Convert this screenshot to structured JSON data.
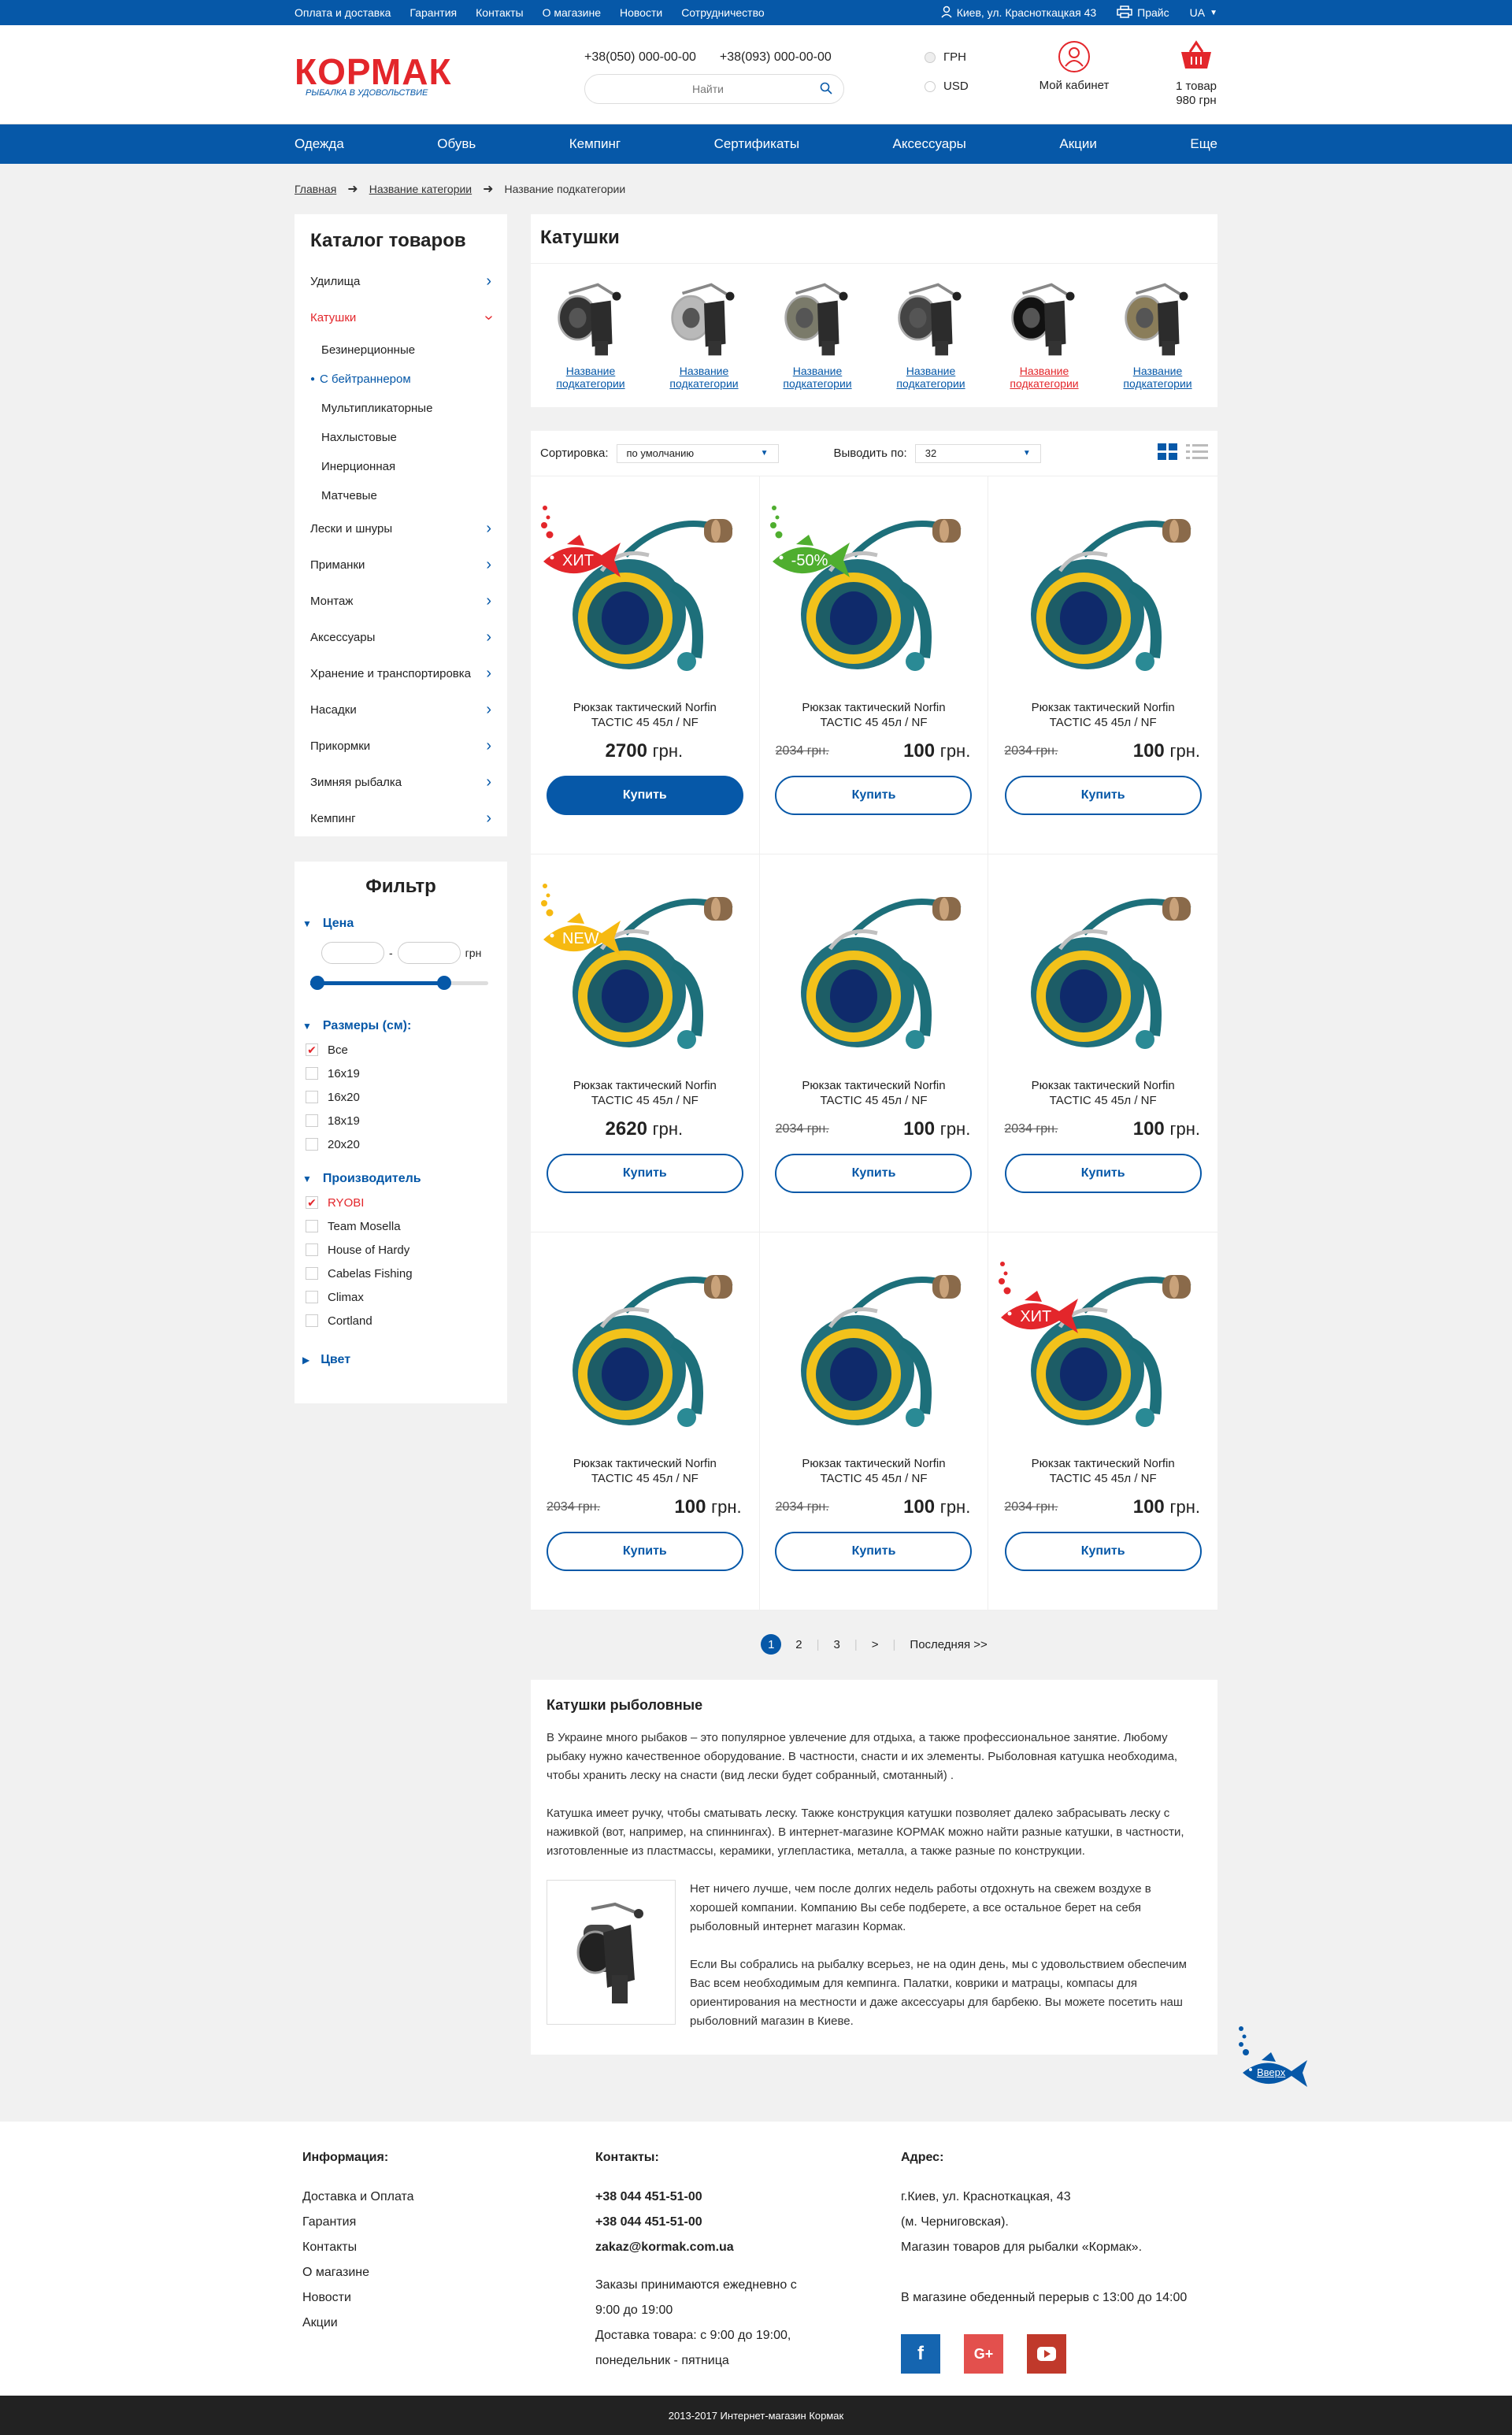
{
  "topbar": {
    "links": [
      "Оплата и доставка",
      "Гарантия",
      "Контакты",
      "О магазине",
      "Новости",
      "Сотрудничество"
    ],
    "address": "Киев, ул. Красноткацкая 43",
    "price": "Прайс",
    "lang": "UA"
  },
  "header": {
    "logo_text": "КОРМАК",
    "logo_slogan": "РЫБАЛКА В УДОВОЛЬСТВИЕ",
    "phone1": "+38(050) 000-00-00",
    "phone2": "+38(093) 000-00-00",
    "search_placeholder": "Найти",
    "currency": [
      "ГРН",
      "USD"
    ],
    "cabinet": "Мой кабинет",
    "cart_count": "1 товар",
    "cart_sum": "980 грн"
  },
  "nav": [
    "Одежда",
    "Обувь",
    "Кемпинг",
    "Сертификаты",
    "Аксессуары",
    "Акции",
    "Еще"
  ],
  "breadcrumb": [
    "Главная",
    "Название категории",
    "Название подкатегории"
  ],
  "catalog": {
    "title": "Каталог товаров",
    "items": [
      {
        "label": "Удилища"
      },
      {
        "label": "Катушки",
        "active": true,
        "sub": [
          "Безинерционные",
          "С бейтраннером",
          "Мультипликаторные",
          "Нахлыстовые",
          "Инерционная",
          "Матчевые"
        ]
      },
      {
        "label": "Лески и шнуры"
      },
      {
        "label": "Приманки"
      },
      {
        "label": "Монтаж"
      },
      {
        "label": "Аксессуары"
      },
      {
        "label": "Хранение и транспортировка"
      },
      {
        "label": "Насадки"
      },
      {
        "label": "Прикормки"
      },
      {
        "label": "Зимняя рыбалка"
      },
      {
        "label": "Кемпинг"
      }
    ]
  },
  "filter": {
    "title": "Фильтр",
    "price": {
      "label": "Цена",
      "dash": "-",
      "unit": "грн",
      "range_low": 0.0,
      "range_high": 0.75
    },
    "sizes": {
      "label": "Размеры (см):",
      "options": [
        "Все",
        "16x19",
        "16x20",
        "18x19",
        "20x20"
      ]
    },
    "maker": {
      "label": "Производитель",
      "options": [
        "RYOBI",
        "Team Mosella",
        "House of Hardy",
        "Cabelas Fishing",
        "Climax",
        "Cortland"
      ]
    },
    "color": {
      "label": "Цвет"
    }
  },
  "page": {
    "title": "Катушки",
    "subcategory_label": "Название подкатегории"
  },
  "sort": {
    "label": "Сортировка:",
    "value": "по умолчанию",
    "per_page_label": "Выводить по:",
    "per_page": "32"
  },
  "products": [
    {
      "name": "Рюкзак тактический Norfin TACTIC 45 45л / NF",
      "old": "",
      "price": "2700",
      "badge": "ХИТ",
      "badge_color": "#e3262b",
      "filled": true
    },
    {
      "name": "Рюкзак тактический Norfin TACTIC 45 45л / NF",
      "old": "2034 грн.",
      "price": "100",
      "badge": "-50%",
      "badge_color": "#4fae2f",
      "filled": false
    },
    {
      "name": "Рюкзак тактический Norfin TACTIC 45 45л / NF",
      "old": "2034 грн.",
      "price": "100",
      "badge": "",
      "filled": false
    },
    {
      "name": "Рюкзак тактический Norfin TACTIC 45 45л / NF",
      "old": "",
      "price": "2620",
      "badge": "NEW",
      "badge_color": "#f6b911",
      "filled": false
    },
    {
      "name": "Рюкзак тактический Norfin TACTIC 45 45л / NF",
      "old": "2034 грн.",
      "price": "100",
      "badge": "",
      "filled": false
    },
    {
      "name": "Рюкзак тактический Norfin TACTIC 45 45л / NF",
      "old": "2034 грн.",
      "price": "100",
      "badge": "",
      "filled": false
    },
    {
      "name": "Рюкзак тактический Norfin TACTIC 45 45л / NF",
      "old": "2034 грн.",
      "price": "100",
      "badge": "",
      "filled": false
    },
    {
      "name": "Рюкзак тактический Norfin TACTIC 45 45л / NF",
      "old": "2034 грн.",
      "price": "100",
      "badge": "",
      "filled": false
    },
    {
      "name": "Рюкзак тактический Norfin TACTIC 45 45л / NF",
      "old": "2034 грн.",
      "price": "100",
      "badge": "ХИТ",
      "badge_color": "#e3262b",
      "filled": false
    }
  ],
  "currency_unit": "грн.",
  "buy_label": "Купить",
  "pager": {
    "pages": [
      "1",
      "2",
      "3"
    ],
    "next": ">",
    "last": "Последняя >>"
  },
  "seo": {
    "title": "Катушки рыболовные",
    "p1": "В Украине много рыбаков – это популярное увлечение для отдыха, а также профессиональное занятие. Любому рыбаку нужно качественное оборудование. В частности, снасти и их элементы. Рыболовная катушка необходима, чтобы хранить леску на снасти (вид лески будет собранный, смотанный) .",
    "p2": "Катушка имеет ручку, чтобы сматывать леску. Также конструкция катушки позволяет далеко забрасывать леску с наживкой (вот, например, на спиннингах). В интернет-магазине КОРМАК можно найти разные катушки, в частности, изготовленные из пластмассы, керамики, углепластика, металла, а также разные по конструкции.",
    "p3": "Нет ничего лучше, чем после долгих недель работы отдохнуть на свежем воздухе в хорошей компании. Компанию Вы себе подберете, а все остальное берет на себя рыболовный интернет магазин Кормак.",
    "p4": "Если Вы собрались на рыбалку всерьез, не на один день, мы с удовольствием обеспечим Вас всем необходимым для кемпинга. Палатки, коврики и матрацы, компасы для ориентирования на местности и даже аксессуары для барбекю. Вы можете посетить наш рыболовний магазин в Киеве."
  },
  "up_label": "Вверх",
  "footer": {
    "info_title": "Информация:",
    "info_links": [
      "Доставка и Оплата",
      "Гарантия",
      "Контакты",
      "О магазине",
      "Новости",
      "Акции"
    ],
    "contacts_title": "Контакты:",
    "phone1": "+38 044 451-51-00",
    "phone2": "+38 044 451-51-00",
    "email": "zakaz@kormak.com.ua",
    "hours1": "Заказы принимаются ежедневно с",
    "hours2": "9:00 до 19:00",
    "hours3": "Доставка товара: с 9:00 до 19:00,",
    "hours4": "понедельник - пятница",
    "address_title": "Адрес:",
    "addr1": "г.Киев, ул. Красноткацкая, 43",
    "addr2": "(м. Черниговская).",
    "addr3": "Магазин товаров для рыбалки «Кормак».",
    "addr4": "В магазине обеденный перерыв с 13:00 до 14:00",
    "social_colors": [
      "#1565b0",
      "#e3504d",
      "#c0392b"
    ]
  },
  "copyright": "2013-2017 Интернет-магазин Кормак"
}
